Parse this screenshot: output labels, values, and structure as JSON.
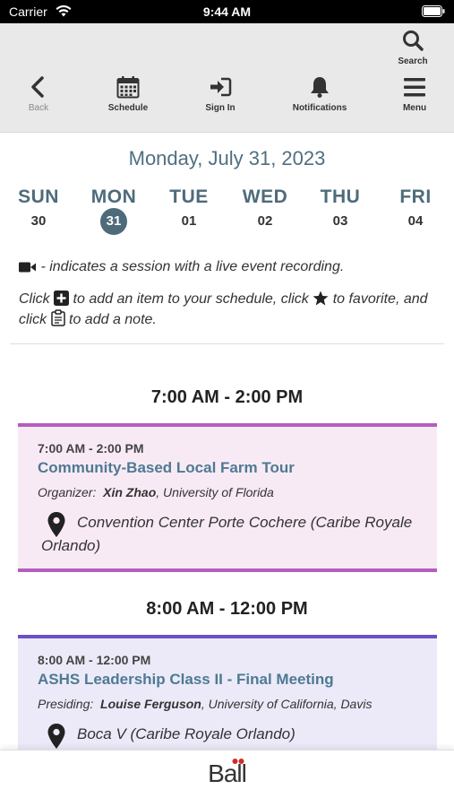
{
  "status_bar": {
    "carrier": "Carrier",
    "time": "9:44 AM"
  },
  "toolbar": {
    "search": "Search",
    "back": "Back",
    "schedule": "Schedule",
    "sign_in": "Sign In",
    "notifications": "Notifications",
    "menu": "Menu"
  },
  "date_title": "Monday, July 31, 2023",
  "days": [
    {
      "name": "SUN",
      "num": "30"
    },
    {
      "name": "MON",
      "num": "31",
      "selected": true
    },
    {
      "name": "TUE",
      "num": "01"
    },
    {
      "name": "WED",
      "num": "02"
    },
    {
      "name": "THU",
      "num": "03"
    },
    {
      "name": "FRI",
      "num": "04"
    }
  ],
  "info": {
    "recording": " - indicates a session with a live event recording.",
    "click": "Click ",
    "add": " to add an item to your schedule, click ",
    "favorite": " to favorite, and click ",
    "note": " to add a note."
  },
  "sessions": [
    {
      "slot": "7:00 AM - 2:00 PM",
      "time": "7:00 AM - 2:00 PM",
      "title": "Community-Based Local Farm Tour",
      "role": "Organizer:",
      "person": "Xin Zhao",
      "affiliation": ", University of Florida",
      "location": "Convention Center Porte Cochere (Caribe Royale Orlando)",
      "accent": "#b35dbf"
    },
    {
      "slot": "8:00 AM - 12:00 PM",
      "time": "8:00 AM - 12:00 PM",
      "title": "ASHS Leadership Class II - Final Meeting",
      "role": "Presiding:",
      "person": "Louise Ferguson",
      "affiliation": ", University of California, Davis",
      "location": "Boca V (Caribe Royale Orlando)",
      "accent": "#6b4fc8"
    }
  ],
  "footer": {
    "logo": "Ball"
  }
}
